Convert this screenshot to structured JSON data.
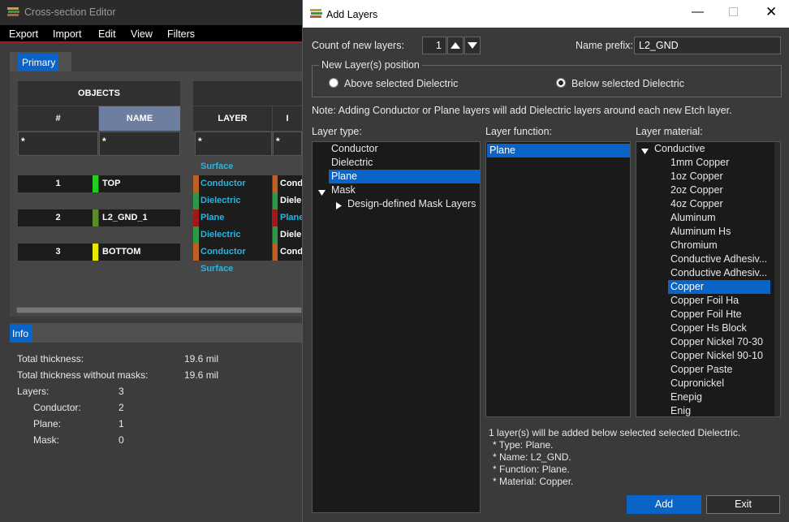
{
  "bg": {
    "title": "Cross-section Editor",
    "menu": [
      "Export",
      "Import",
      "Edit",
      "View",
      "Filters"
    ],
    "tab_primary": "Primary",
    "tab_info": "Info",
    "objects_header": "OBJECTS",
    "col_num": "#",
    "col_name": "NAME",
    "col_layer": "LAYER",
    "filter_value": "*",
    "objects": [
      {
        "num": "1",
        "name": "TOP",
        "color": "#22cc22"
      },
      {
        "num": "2",
        "name": "L2_GND_1",
        "color": "#5a8a2a"
      },
      {
        "num": "3",
        "name": "BOTTOM",
        "color": "#e8e800"
      }
    ],
    "layers": [
      {
        "label": "Surface",
        "color": ""
      },
      {
        "label": "Conductor",
        "color": "#c06020",
        "side": "Cond"
      },
      {
        "label": "Dielectric",
        "color": "#2a9a4a",
        "side": "Diele"
      },
      {
        "label": "Plane",
        "color": "#a01818",
        "side": "Plane"
      },
      {
        "label": "Dielectric",
        "color": "#2a9a4a",
        "side": "Diele"
      },
      {
        "label": "Conductor",
        "color": "#c06020",
        "side": "Cond"
      },
      {
        "label": "Surface",
        "color": ""
      }
    ],
    "info": {
      "total_thickness_label": "Total thickness:",
      "total_thickness_value": "19.6 mil",
      "without_masks_label": "Total thickness without masks:",
      "without_masks_value": "19.6 mil",
      "layers_label": "Layers:",
      "layers_value": "3",
      "conductor_label": "Conductor:",
      "conductor_value": "2",
      "plane_label": "Plane:",
      "plane_value": "1",
      "mask_label": "Mask:",
      "mask_value": "0"
    }
  },
  "dialog": {
    "title": "Add Layers",
    "count_label": "Count of new layers:",
    "count_value": "1",
    "prefix_label": "Name prefix:",
    "prefix_value": "L2_GND",
    "position_group": "New Layer(s) position",
    "above_label": "Above selected Dielectric",
    "below_label": "Below selected Dielectric",
    "position_selected": "below",
    "note": "Note: Adding Conductor or Plane layers will add Dielectric layers around each new Etch layer.",
    "type_label": "Layer type:",
    "function_label": "Layer function:",
    "material_label": "Layer material:",
    "types": [
      "Conductor",
      "Dielectric",
      "Plane",
      "Mask",
      "Design-defined Mask Layers"
    ],
    "type_selected": "Plane",
    "functions": [
      "Plane"
    ],
    "material_group": "Conductive",
    "materials": [
      "1mm Copper",
      "1oz Copper",
      "2oz Copper",
      "4oz Copper",
      "Aluminum",
      "Aluminum Hs",
      "Chromium",
      "Conductive Adhesiv...",
      "Conductive Adhesiv...",
      "Copper",
      "Copper Foil Ha",
      "Copper Foil Hte",
      "Copper Hs Block",
      "Copper Nickel 70-30",
      "Copper Nickel 90-10",
      "Copper Paste",
      "Cupronickel",
      "Enepig",
      "Enig"
    ],
    "material_selected": "Copper",
    "summary": [
      "1 layer(s) will be added below selected selected Dielectric.",
      "* Type: Plane.",
      "* Name: L2_GND.",
      "* Function: Plane.",
      "* Material: Copper."
    ],
    "add_label": "Add",
    "exit_label": "Exit"
  }
}
